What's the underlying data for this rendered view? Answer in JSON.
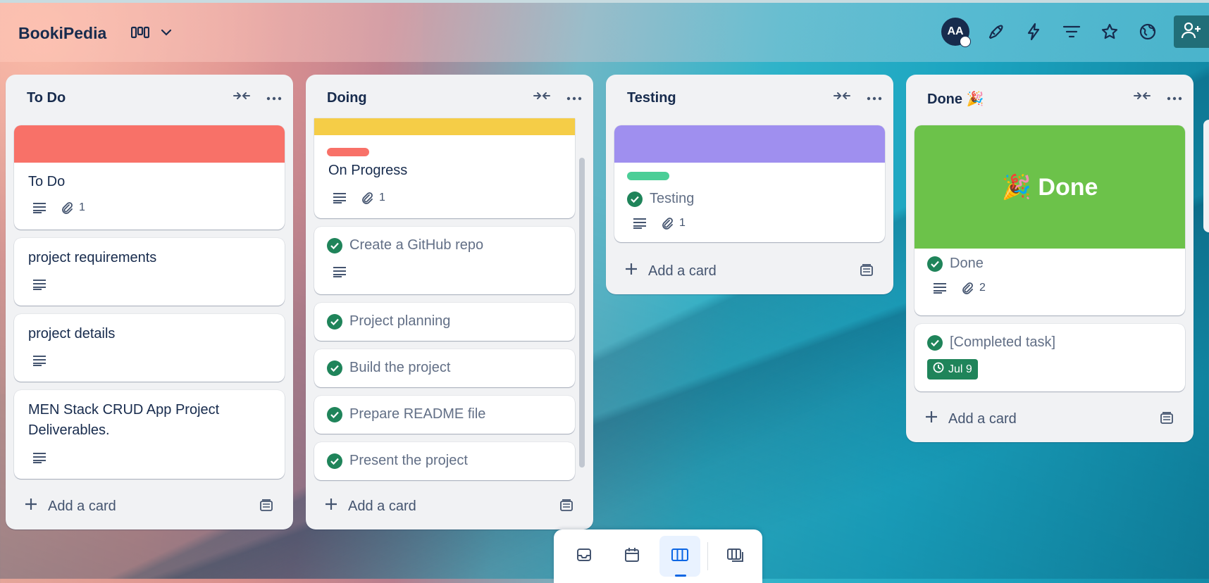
{
  "board": {
    "title": "BookiPedia",
    "member_initials": "AA"
  },
  "lists": [
    {
      "title": "To Do",
      "add_label": "Add a card",
      "cards": [
        {
          "title": "To Do",
          "cover": "#f87168",
          "attachments": "1"
        },
        {
          "title": "project requirements"
        },
        {
          "title": "project details"
        },
        {
          "title": "MEN Stack CRUD App Project Deliverables."
        }
      ]
    },
    {
      "title": "Doing",
      "add_label": "Add a card",
      "cards": [
        {
          "title": "On Progress",
          "cover": "#f5cd47",
          "label_color": "#f87168",
          "attachments": "1"
        },
        {
          "title": "Create a GitHub repo",
          "completed": true
        },
        {
          "title": "Project planning",
          "completed": true
        },
        {
          "title": "Build the project",
          "completed": true
        },
        {
          "title": "Prepare README file",
          "completed": true
        },
        {
          "title": "Present the project",
          "completed": true
        }
      ]
    },
    {
      "title": "Testing",
      "add_label": "Add a card",
      "cards": [
        {
          "title": "Testing",
          "cover": "#9f8fef",
          "label_color": "#4bce97",
          "completed": true,
          "attachments": "1"
        }
      ]
    },
    {
      "title": "Done 🎉",
      "add_label": "Add a card",
      "cards": [
        {
          "title": "Done",
          "cover": "#6cc24a",
          "cover_text": "🎉 Done",
          "completed": true,
          "attachments": "2"
        },
        {
          "title": "[Completed task]",
          "completed": true,
          "due": "Jul 9"
        }
      ]
    }
  ],
  "colors": {
    "accent": "#0c66e4",
    "complete": "#1f845a",
    "share": "#216e78"
  }
}
